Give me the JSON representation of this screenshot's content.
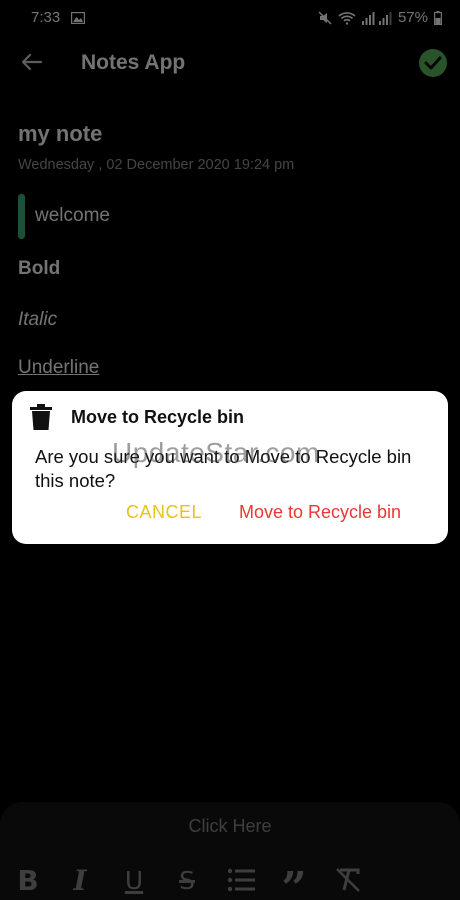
{
  "status_bar": {
    "time": "7:33",
    "battery": "57%"
  },
  "header": {
    "title": "Notes App"
  },
  "note": {
    "title": "my note",
    "date": "Wednesday , 02 December 2020 19:24 pm",
    "quote": "welcome",
    "bold": "Bold",
    "italic": "Italic",
    "underline": "Underline"
  },
  "dialog": {
    "title": "Move to Recycle bin",
    "message": "Are you sure you want to Move to Recycle bin this note?",
    "cancel_label": "CANCEL",
    "confirm_label": "Move to Recycle bin"
  },
  "watermark": "UpdateStar.com",
  "bottom_panel": {
    "click_here": "Click Here",
    "tools": {
      "bold": "B",
      "italic": "I",
      "underline": "U",
      "strike": "S",
      "quote": "”"
    }
  },
  "colors": {
    "accent_green": "#3bb77e",
    "check_green": "#5cb85c",
    "cancel_yellow": "#e8c21a",
    "confirm_red": "#e53935"
  },
  "icons": [
    "image-icon",
    "mute-icon",
    "wifi-icon",
    "signal-icon",
    "battery-icon",
    "back-arrow-icon",
    "check-icon",
    "trash-icon",
    "bulleted-list-icon",
    "clear-format-icon"
  ]
}
